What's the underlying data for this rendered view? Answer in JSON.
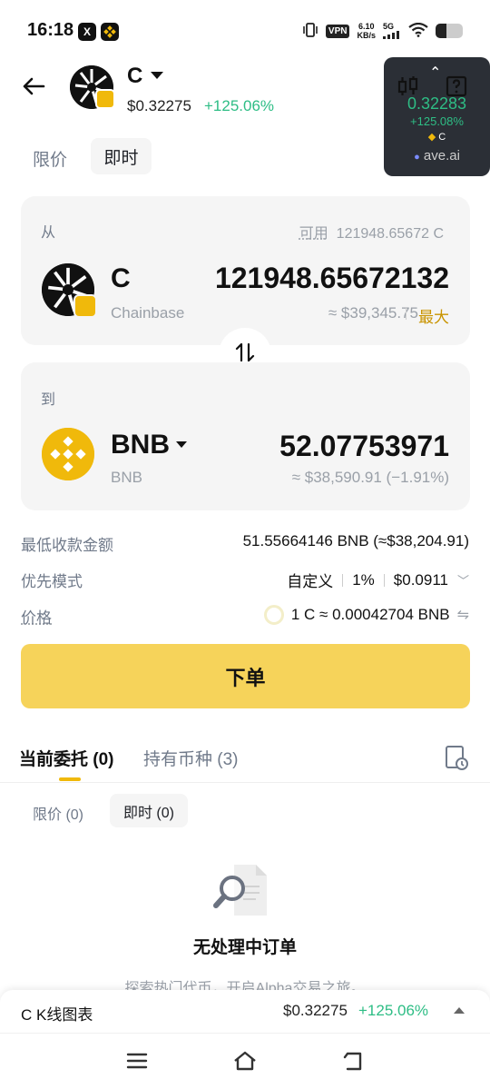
{
  "status_bar": {
    "time": "16:18",
    "vpn": "VPN",
    "speed_value": "6.10",
    "speed_unit": "KB/s",
    "network": "5G",
    "icons": [
      "x-app-icon",
      "binance-app-icon",
      "vibrate-icon",
      "signal-icon",
      "wifi-icon",
      "battery-icon"
    ]
  },
  "header": {
    "symbol": "C",
    "price": "$0.32275",
    "change": "+125.06%"
  },
  "widget": {
    "price": "0.32283",
    "change": "+125.08%",
    "symbol": "C",
    "source": "ave.ai"
  },
  "tabs": {
    "limit": "限价",
    "market": "即时"
  },
  "from": {
    "label": "从",
    "available_label": "可用",
    "available_value": "121948.65672 C",
    "symbol": "C",
    "name": "Chainbase",
    "amount": "121948.65672132",
    "usd": "≈ $39,345.75",
    "max": "最大"
  },
  "to": {
    "label": "到",
    "symbol": "BNB",
    "name": "BNB",
    "amount": "52.07753971",
    "usd": "≈ $38,590.91 (−1.91%)"
  },
  "details": {
    "min_receive_label": "最低收款金额",
    "min_receive_value": "51.55664146 BNB (≈$38,204.91)",
    "priority_label": "优先模式",
    "priority_mode": "自定义",
    "priority_slippage": "1%",
    "priority_fee": "$0.0911",
    "price_label": "价格",
    "price_value": "1 C ≈ 0.00042704 BNB"
  },
  "order_button": "下单",
  "bottom_tabs": {
    "open_orders": "当前委托 (0)",
    "holdings": "持有币种 (3)"
  },
  "sub_tabs": {
    "limit": "限价 (0)",
    "market": "即时 (0)"
  },
  "empty": {
    "title": "无处理中订单",
    "subtitle": "探索热门代币，开启Alpha交易之旅。"
  },
  "chart_bar": {
    "title": "C K线图表",
    "price": "$0.32275",
    "change": "+125.06%"
  },
  "colors": {
    "up": "#2ebd85",
    "brand": "#f0b90b",
    "button": "#f6d35a",
    "muted": "#707a8a"
  }
}
